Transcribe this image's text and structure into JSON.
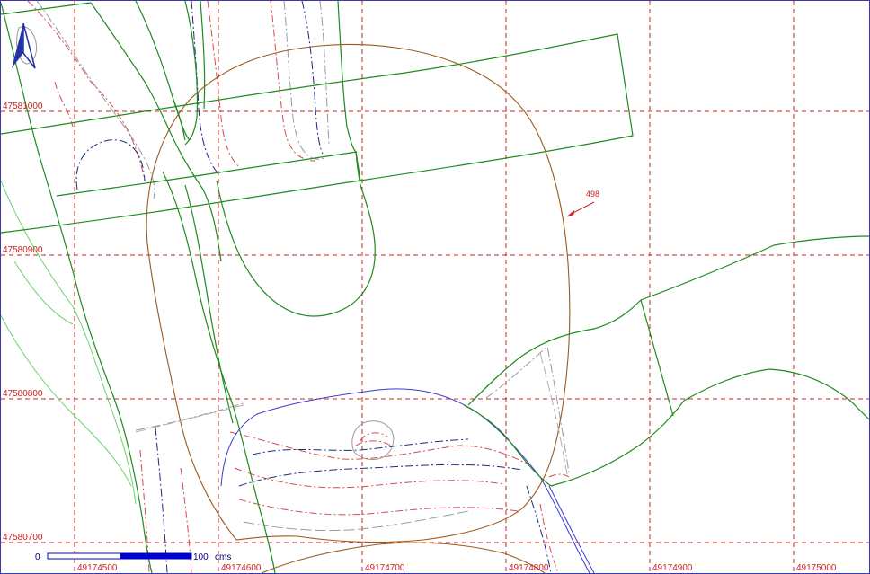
{
  "map": {
    "grid": {
      "easting_labels": [
        "49174500",
        "49174600",
        "49174700",
        "49174800",
        "49174900",
        "49175000"
      ],
      "northing_labels": [
        "47581000",
        "47580900",
        "47580800",
        "47580700"
      ],
      "color": "#cc2222"
    },
    "annotation": {
      "label": "498"
    },
    "scale_bar": {
      "start_label": "0",
      "end_label": "100",
      "unit_label": "cms",
      "color": "#0000cc"
    },
    "north_arrow": {
      "icon": "north-arrow-icon",
      "color": "#2233aa"
    },
    "colors": {
      "parcel_lines": "#1f8a1f",
      "contour_main": "#9a5a1e",
      "contour_red": "#d64b4b",
      "contour_navy": "#1a2a80",
      "contour_blue": "#3a3ad0",
      "contour_gray": "#9a9a9a",
      "light_green": "#6ad36a"
    }
  }
}
